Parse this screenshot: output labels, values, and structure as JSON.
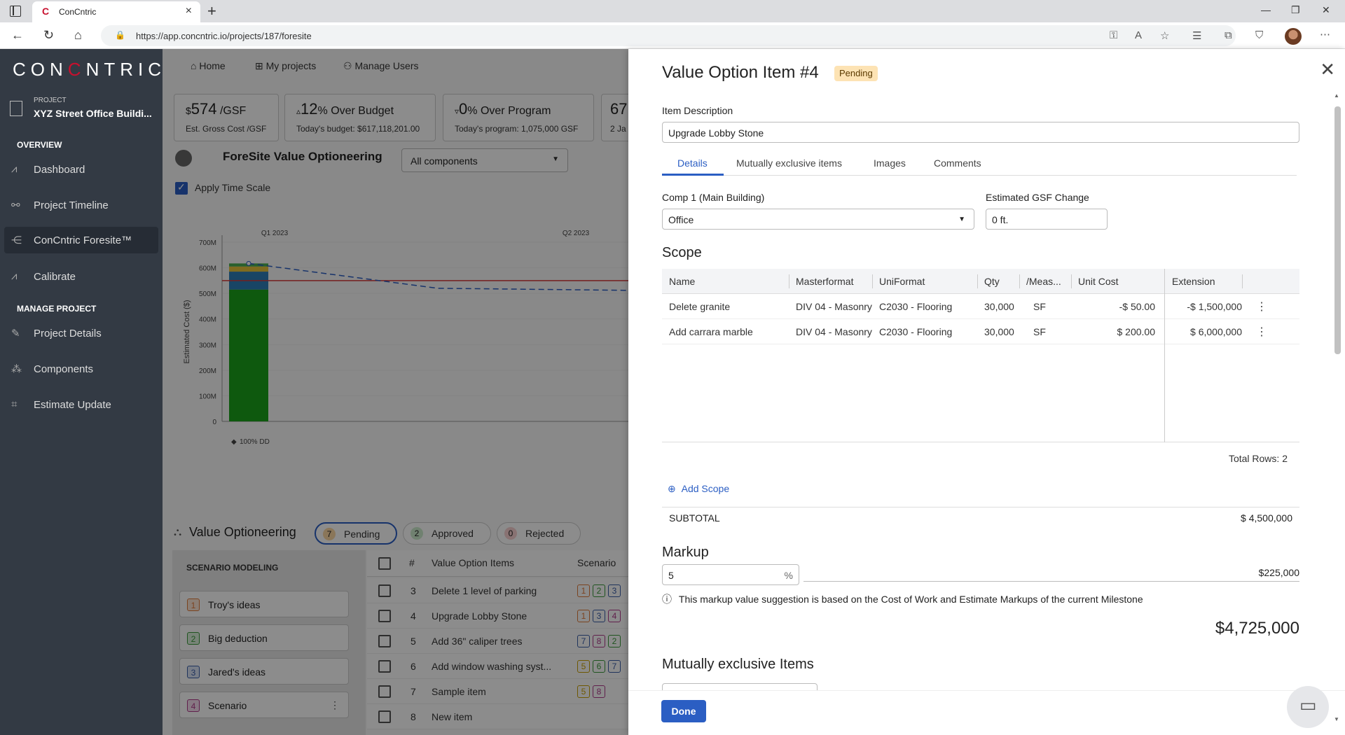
{
  "browser": {
    "tab_title": "ConCntric",
    "tab_logo": "C",
    "url": "https://app.concntric.io/projects/187/foresite"
  },
  "sidebar": {
    "logo": "CONCNTRIC",
    "project_label": "PROJECT",
    "project_name": "XYZ Street Office Buildi...",
    "overview_header": "OVERVIEW",
    "manage_header": "MANAGE PROJECT",
    "items": [
      {
        "label": "Dashboard",
        "icon": "chart-line-icon"
      },
      {
        "label": "Project Timeline",
        "icon": "timeline-icon"
      },
      {
        "label": "ConCntric Foresite™",
        "icon": "foresite-icon",
        "active": true
      },
      {
        "label": "Calibrate",
        "icon": "calibrate-icon"
      },
      {
        "label": "Project Details",
        "icon": "project-details-icon"
      },
      {
        "label": "Components",
        "icon": "components-icon"
      },
      {
        "label": "Estimate Update",
        "icon": "estimate-update-icon"
      }
    ]
  },
  "topnav": {
    "home": "Home",
    "my_projects": "My projects",
    "manage_users": "Manage Users"
  },
  "stats": [
    {
      "prefix": "$",
      "big": "574",
      "suffix": " /GSF",
      "sub": "Est. Gross Cost /GSF"
    },
    {
      "prefix": "▵",
      "big": "12",
      "suffix": "% Over Budget",
      "sub": "Today's budget: $617,118,201.00"
    },
    {
      "prefix": "▿",
      "big": "0",
      "suffix": "% Over Program",
      "sub": "Today's program: 1,075,000 GSF"
    },
    {
      "prefix": "",
      "big": "67",
      "suffix": "",
      "sub": "2 Ja"
    }
  ],
  "foresite": {
    "title": "ForeSite Value Optioneering",
    "component_select": "All components",
    "apply_time_scale": "Apply Time Scale"
  },
  "chart_data": {
    "type": "bar",
    "ylabel": "Estimated Cost ($)",
    "y_ticks": [
      "700M",
      "600M",
      "500M",
      "400M",
      "300M",
      "200M",
      "100M",
      "0"
    ],
    "x_ticks": [
      "Q1 2023",
      "Q2 2023"
    ],
    "ylim": [
      0,
      700
    ],
    "milestone_label": "100% DD",
    "bar_segments": [
      {
        "color": "#1aa31a",
        "value": 515
      },
      {
        "color": "#2e7fb8",
        "value": 70
      },
      {
        "color": "#e8c43a",
        "value": 20
      },
      {
        "color": "#4caf50",
        "value": 12
      }
    ],
    "budget_line": 550,
    "projection_line": [
      [
        0,
        617
      ],
      [
        0.5,
        520
      ],
      [
        1,
        512
      ]
    ]
  },
  "value_optioneering": {
    "title": "Value Optioneering",
    "pills": [
      {
        "count": "7",
        "label": "Pending",
        "color": "#fbd7a3"
      },
      {
        "count": "2",
        "label": "Approved",
        "color": "#cdeccd"
      },
      {
        "count": "0",
        "label": "Rejected",
        "color": "#f8cfcf"
      }
    ],
    "scenario_header": "SCENARIO MODELING",
    "scenarios": [
      {
        "n": "1",
        "name": "Troy's ideas",
        "color": "#e07a3a",
        "bg": "#fde6d6"
      },
      {
        "n": "2",
        "name": "Big deduction",
        "color": "#3a9a3a",
        "bg": "#daf0da"
      },
      {
        "n": "3",
        "name": "Jared's ideas",
        "color": "#3a5ea8",
        "bg": "#dae4f6"
      },
      {
        "n": "4",
        "name": "Scenario",
        "color": "#b03a8a",
        "bg": "#f6dcee"
      }
    ],
    "table_headers": {
      "num": "#",
      "name": "Value Option Items",
      "scenario": "Scenario"
    },
    "rows": [
      {
        "num": "3",
        "name": "Delete 1 level of parking",
        "chips": [
          "1",
          "2",
          "3"
        ]
      },
      {
        "num": "4",
        "name": "Upgrade Lobby Stone",
        "chips": [
          "1",
          "3",
          "4"
        ]
      },
      {
        "num": "5",
        "name": "Add 36\" caliper trees",
        "chips": [
          "7",
          "8",
          "2"
        ]
      },
      {
        "num": "6",
        "name": "Add window washing syst...",
        "chips": [
          "5",
          "6",
          "7"
        ]
      },
      {
        "num": "7",
        "name": "Sample item",
        "chips": [
          "5",
          "8"
        ]
      },
      {
        "num": "8",
        "name": "New item",
        "chips": []
      }
    ]
  },
  "drawer": {
    "title": "Value Option Item #4",
    "status": "Pending",
    "item_description_label": "Item Description",
    "item_description": "Upgrade Lobby Stone",
    "tabs": [
      "Details",
      "Mutually exclusive items",
      "Images",
      "Comments"
    ],
    "comp_label": "Comp 1 (Main Building)",
    "comp_value": "Office",
    "gsf_label": "Estimated GSF Change",
    "gsf_value": "0 ft.",
    "scope_title": "Scope",
    "scope_headers": [
      "Name",
      "Masterformat",
      "UniFormat",
      "Qty",
      "/Meas...",
      "Unit Cost",
      "Extension"
    ],
    "scope_rows": [
      [
        "Delete granite",
        "DIV 04 - Masonry",
        "C2030 - Flooring",
        "30,000",
        "SF",
        "-$ 50.00",
        "-$ 1,500,000"
      ],
      [
        "Add carrara marble",
        "DIV 04 - Masonry",
        "C2030 - Flooring",
        "30,000",
        "SF",
        "$ 200.00",
        "$ 6,000,000"
      ]
    ],
    "total_rows": "Total Rows: 2",
    "add_scope": "Add Scope",
    "subtotal_label": "SUBTOTAL",
    "subtotal_value": "$ 4,500,000",
    "markup_title": "Markup",
    "markup_value": "5",
    "markup_unit": "%",
    "markup_amount": "$225,000",
    "markup_note": "This markup value suggestion is based on the Cost of Work and Estimate Markups of the current Milestone",
    "grand_total": "$4,725,000",
    "mutually_exclusive_title": "Mutually exclusive Items",
    "done": "Done"
  }
}
